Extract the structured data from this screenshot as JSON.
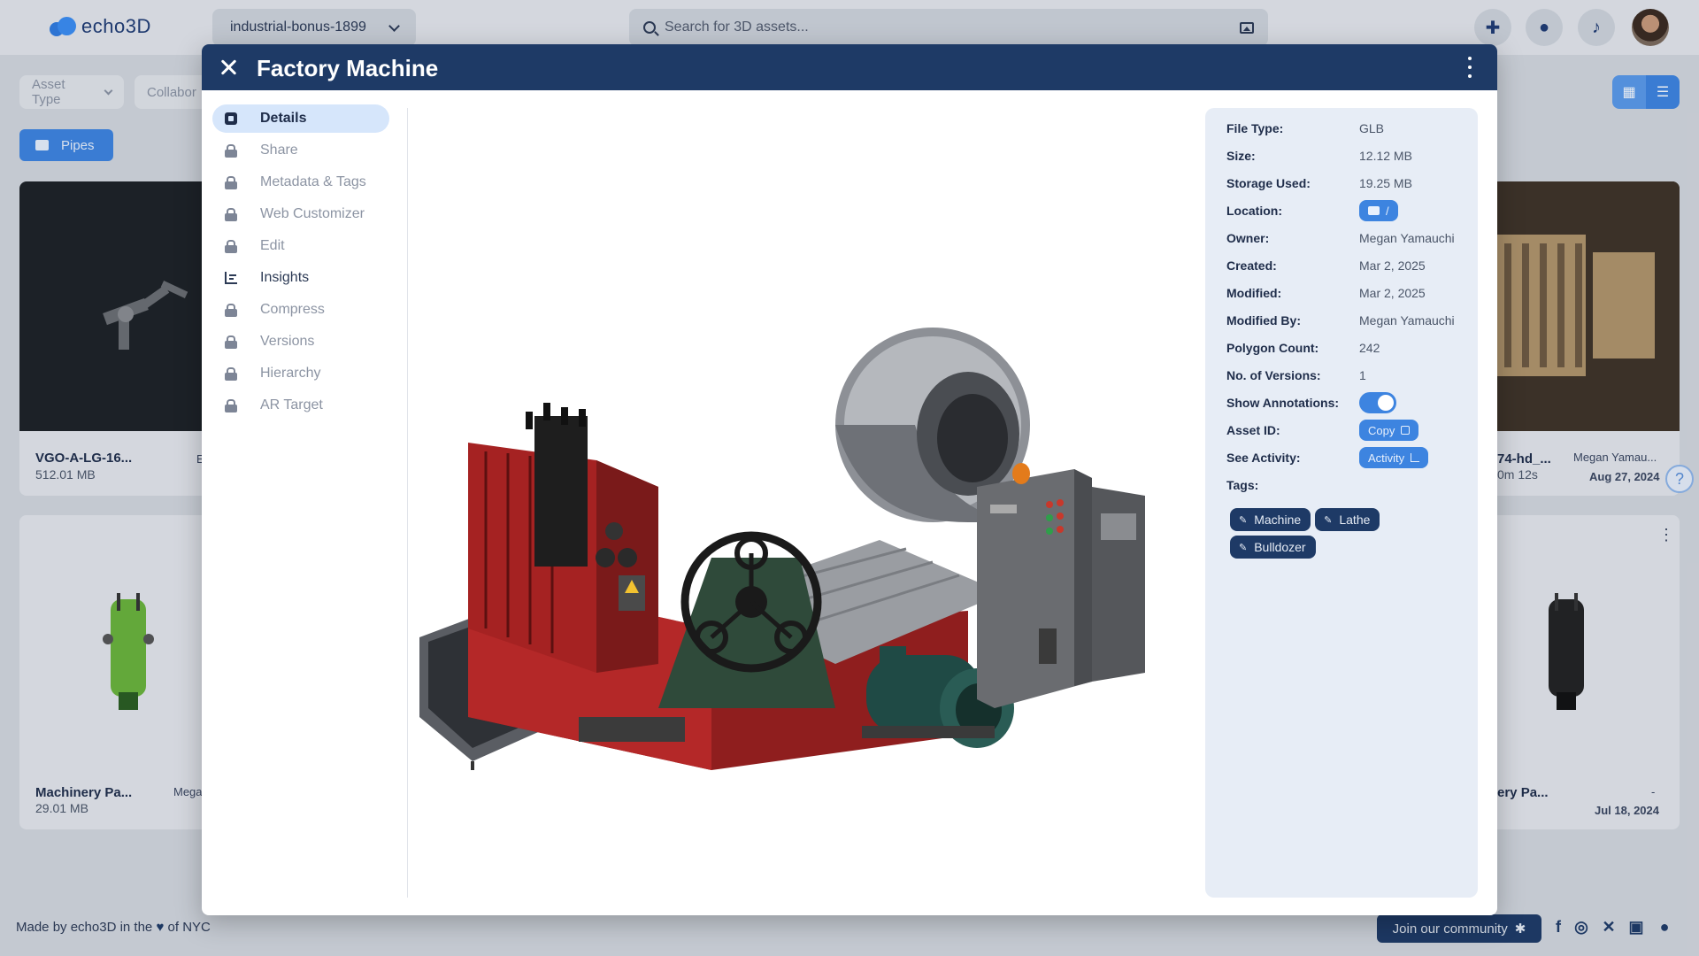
{
  "app": {
    "logo_text": "echo3D",
    "project": "industrial-bonus-1899",
    "search_placeholder": "Search for 3D assets..."
  },
  "filters": {
    "asset_type": "Asset Type",
    "collaborators": "Collabor",
    "folder": "Pipes"
  },
  "cards": [
    {
      "title": "VGO-A-LG-16...",
      "size": "512.01 MB",
      "owner": "E"
    },
    {
      "title": "Machinery Pa...",
      "size": "29.01 MB",
      "owner": "Mega"
    },
    {
      "title": "74-hd_...",
      "size": "0m 12s",
      "owner": "Megan Yamau...",
      "date": "Aug 27, 2024"
    },
    {
      "title": "ery Pa...",
      "owner": "-",
      "date": "Jul 18, 2024"
    }
  ],
  "modal": {
    "title": "Factory Machine",
    "nav": [
      {
        "label": "Details",
        "state": "active",
        "icon": "cube-icon"
      },
      {
        "label": "Share",
        "state": "locked",
        "icon": "lock-icon"
      },
      {
        "label": "Metadata & Tags",
        "state": "locked",
        "icon": "lock-icon"
      },
      {
        "label": "Web Customizer",
        "state": "locked",
        "icon": "lock-icon"
      },
      {
        "label": "Edit",
        "state": "locked",
        "icon": "lock-icon"
      },
      {
        "label": "Insights",
        "state": "enabled",
        "icon": "bar-chart-icon"
      },
      {
        "label": "Compress",
        "state": "locked",
        "icon": "lock-icon"
      },
      {
        "label": "Versions",
        "state": "locked",
        "icon": "lock-icon"
      },
      {
        "label": "Hierarchy",
        "state": "locked",
        "icon": "lock-icon"
      },
      {
        "label": "AR Target",
        "state": "locked",
        "icon": "lock-icon"
      }
    ],
    "details": {
      "file_type_label": "File Type:",
      "file_type": "GLB",
      "size_label": "Size:",
      "size": "12.12 MB",
      "storage_label": "Storage Used:",
      "storage": "19.25 MB",
      "location_label": "Location:",
      "location": "/",
      "owner_label": "Owner:",
      "owner": "Megan Yamauchi",
      "created_label": "Created:",
      "created": "Mar 2, 2025",
      "modified_label": "Modified:",
      "modified": "Mar 2, 2025",
      "modified_by_label": "Modified By:",
      "modified_by": "Megan Yamauchi",
      "polygon_label": "Polygon Count:",
      "polygon": "242",
      "versions_label": "No. of Versions:",
      "versions": "1",
      "annotations_label": "Show Annotations:",
      "annotations_on": true,
      "asset_id_label": "Asset ID:",
      "copy_label": "Copy",
      "activity_label": "See Activity:",
      "activity_btn": "Activity",
      "tags_label": "Tags:",
      "tags": [
        "Machine",
        "Lathe",
        "Bulldozer"
      ]
    }
  },
  "footer": {
    "made_by_prefix": "Made by echo3D in the",
    "made_by_suffix": "of NYC",
    "community": "Join our community"
  },
  "colors": {
    "header": "#1e3a66",
    "accent": "#3d84e0",
    "panel": "#e7edf6"
  }
}
